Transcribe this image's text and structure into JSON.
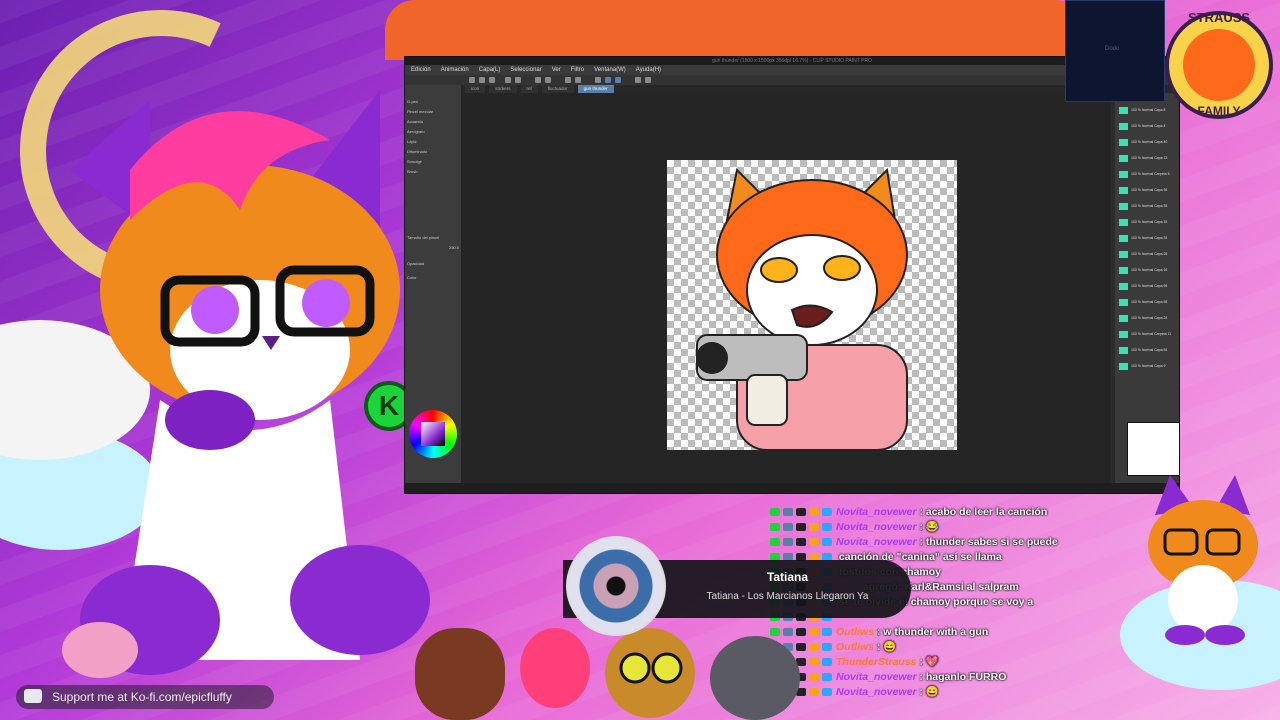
{
  "app": {
    "title": "gun thunder (1500 x 1500px 350dpi 16.7%) - CLIP STUDIO PAINT PRO",
    "menu": [
      "Edición",
      "Animación",
      "Capa(L)",
      "Seleccionar",
      "Ver",
      "Filtro",
      "Ventana(W)",
      "Ayuda(H)"
    ],
    "doc_tabs": [
      "icon",
      "stickers",
      "ref",
      "fluctuador",
      "gun thunder"
    ],
    "active_tab": "gun thunder",
    "left_panel_rows": [
      "G-pen",
      "Pincel mezclar",
      "Acuarela",
      "Aerógrafo",
      "Lápiz",
      "Difuminado",
      "Smudge",
      "Brush",
      "Tamaño del pincel",
      "Opacidad",
      "Color"
    ],
    "brush_size": "250.0",
    "layers": [
      {
        "name": "100 % Normal Capa 8",
        "selected": false
      },
      {
        "name": "100 % Normal Capa 4",
        "selected": false
      },
      {
        "name": "100 % Normal Capa 40",
        "selected": false
      },
      {
        "name": "100 % Normal Capa 13",
        "selected": false
      },
      {
        "name": "100 % Normal Carpeta 5",
        "selected": false
      },
      {
        "name": "100 % Normal Capa 36",
        "selected": false
      },
      {
        "name": "100 % Normal Capa 35",
        "selected": false
      },
      {
        "name": "100 % Normal Capa 15",
        "selected": false
      },
      {
        "name": "100 % Normal Capa 34",
        "selected": false
      },
      {
        "name": "100 % Normal Capa 26",
        "selected": false
      },
      {
        "name": "100 % Normal Capa 16",
        "selected": false
      },
      {
        "name": "100 % Normal Capa 59",
        "selected": false
      },
      {
        "name": "100 % Normal Capa 58",
        "selected": false
      },
      {
        "name": "100 % Normal Capa 24",
        "selected": false
      },
      {
        "name": "100 % Normal Carpeta 11",
        "selected": false
      },
      {
        "name": "100 % Normal Capa 54",
        "selected": false
      },
      {
        "name": "100 % Normal Capa 9",
        "selected": false
      }
    ]
  },
  "webcam": {
    "label": "Dodo"
  },
  "badge": {
    "line1": "STRAUSS",
    "line2": "FAMILY"
  },
  "chat": [
    {
      "user": "Novita_novewer",
      "msg": ": acabo de leer la canción",
      "color": "#a63cff"
    },
    {
      "user": "Novita_novewer",
      "msg": ": 😂",
      "color": "#a63cff"
    },
    {
      "user": "Novita_novewer",
      "msg": ": thunder sabes si se puede",
      "color": "#a63cff"
    },
    {
      "user": "",
      "msg": "canción de \"canina\" así se llama",
      "color": "#a63cff"
    },
    {
      "user": "",
      "msg": "tostitos con chamoy",
      "color": "#a63cff"
    },
    {
      "user": "Lexy",
      "msg": "agregó: Karl&Ramsi al salpram",
      "color": "#ff6ad6"
    },
    {
      "user": "",
      "msg": "se te olvide el chamoy porque se voy a",
      "color": "#a63cff"
    },
    {
      "user": "",
      "msg": "",
      "color": "#a63cff"
    },
    {
      "user": "Outliws",
      "msg": ": w thunder with a gun",
      "color": "#ff7a2a"
    },
    {
      "user": "Outliws",
      "msg": ": 😄",
      "color": "#ff7a2a"
    },
    {
      "user": "ThunderStrauss",
      "msg": ": 💖",
      "color": "#ff7a2a"
    },
    {
      "user": "Novita_novewer",
      "msg": ": haganlo FURRO",
      "color": "#a63cff"
    },
    {
      "user": "Novita_novewer",
      "msg": ": 😄",
      "color": "#a63cff"
    }
  ],
  "now_playing": {
    "title": "Tatiana",
    "subtitle": "Tatiana - Los Marcianos Llegaron Ya"
  },
  "kofi": {
    "text": "Support me at Ko-fi.com/epicfluffy"
  },
  "k_icon": {
    "letter": "K"
  },
  "colors": {
    "accent_orange": "#f0662a",
    "layer_thumb": "#34e6b5",
    "chat_purple": "#a63cff"
  }
}
